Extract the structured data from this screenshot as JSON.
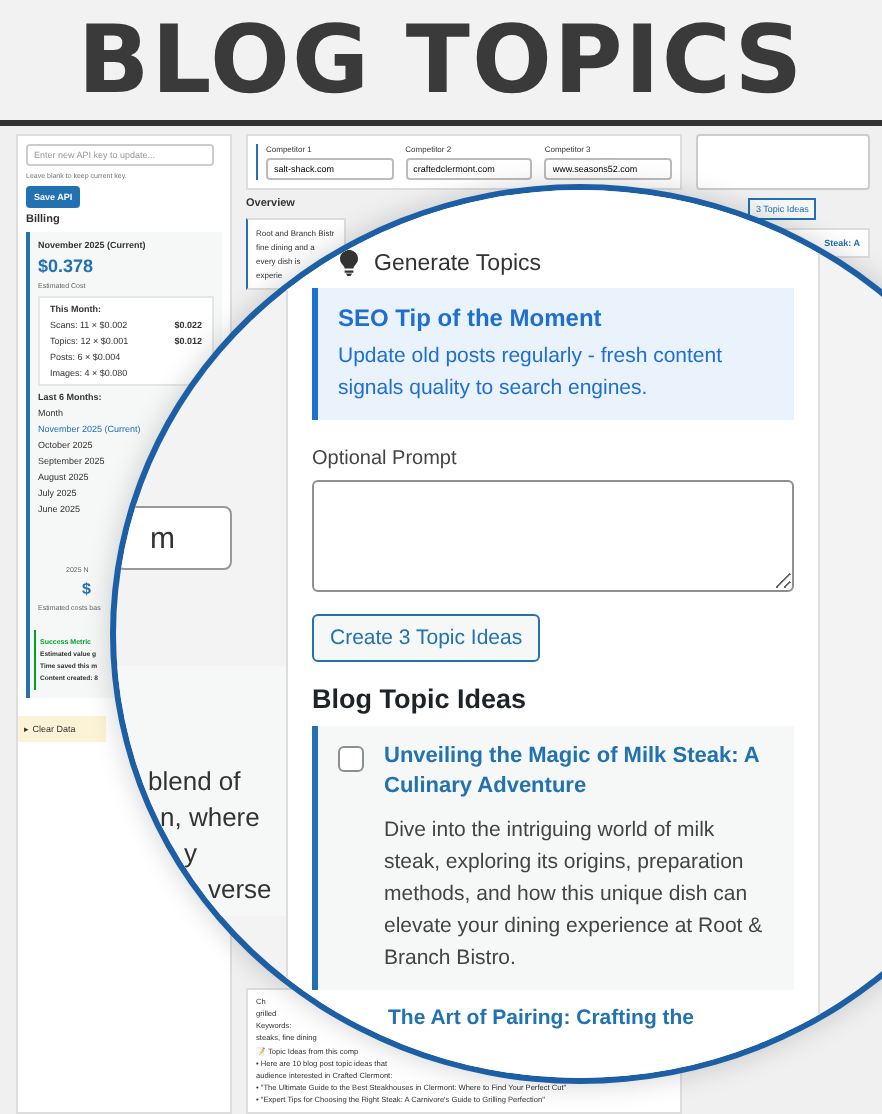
{
  "banner": {
    "title": "BLOG TOPICS"
  },
  "sidebar": {
    "api_key": {
      "placeholder": "Enter new API key to update...",
      "hint": "Leave blank to keep current key."
    },
    "save_button": "Save API",
    "billing": {
      "heading": "Billing",
      "period": "November 2025 (Current)",
      "cost": "$0.378",
      "cost_label": "Estimated Cost",
      "this_month": "This Month:",
      "lines": [
        {
          "label": "Scans: 11 × $0.002",
          "amount": "$0.022"
        },
        {
          "label": "Topics: 12 × $0.001",
          "amount": "$0.012"
        },
        {
          "label": "Posts: 6 × $0.004"
        },
        {
          "label": "Images: 4 × $0.080"
        }
      ],
      "history_heading": "Last 6 Months:",
      "history_column": "Month",
      "months": [
        {
          "label": "November 2025 (Current)",
          "selected": true
        },
        {
          "label": "October 2025",
          "selected": false
        },
        {
          "label": "September 2025",
          "selected": false
        },
        {
          "label": "August 2025",
          "selected": false
        },
        {
          "label": "July 2025",
          "selected": false
        },
        {
          "label": "June 2025",
          "selected": false
        }
      ],
      "summary": {
        "label": "2025 N",
        "value": "$",
        "note": "Estimated costs bas"
      }
    },
    "metrics": {
      "heading": "Success Metric",
      "lines": [
        "Estimated value g",
        "Time saved this m",
        "Content created: 8"
      ]
    },
    "clear_data": "▸ Clear Data"
  },
  "competitors": [
    {
      "label": "Competitor 1",
      "value": "salt-shack.com"
    },
    {
      "label": "Competitor 2",
      "value": "craftedclermont.com"
    },
    {
      "label": "Competitor 3",
      "value": "www.seasons52.com"
    }
  ],
  "overview": {
    "heading": "Overview",
    "lines": [
      "Root and Branch Bistr",
      "fine dining and a",
      "every dish is",
      "experie"
    ]
  },
  "research_notes": {
    "lines": [
      "Ch",
      "grilled",
      "Keywords:",
      "steaks, fine dining"
    ],
    "ideas_heading": "📝 Topic Ideas from this comp",
    "ideas": [
      "• Here are 10 blog post topic ideas that",
      "audience interested in Crafted Clermont:",
      "• \"The Ultimate Guide to the Best Steakhouses in Clermont: Where to Find Your Perfect Cut\"",
      "• \"Expert Tips for Choosing the Right Steak: A Carnivore's Guide to Grilling Perfection\""
    ]
  },
  "right_column": {
    "button": "3 Topic Ideas",
    "item_title": "Steak: A"
  },
  "magnifier": {
    "fragments": {
      "field_value": "m",
      "lines": [
        "blend of",
        "n, where",
        "y",
        "verse"
      ]
    },
    "panel": {
      "heading": "Generate Topics",
      "tip": {
        "title": "SEO Tip of the Moment",
        "text": "Update old posts regularly - fresh content signals quality to search engines."
      },
      "prompt_label": "Optional Prompt",
      "create_button": "Create 3 Topic Ideas",
      "ideas_heading": "Blog Topic Ideas",
      "topics": [
        {
          "title": "Unveiling the Magic of Milk Steak: A Culinary Adventure",
          "description": "Dive into the intriguing world of milk steak, exploring its origins, preparation methods, and how this unique dish can elevate your dining experience at Root & Branch Bistro.",
          "checked": false
        },
        {
          "title": "The Art of Pairing: Crafting the"
        }
      ]
    }
  }
}
